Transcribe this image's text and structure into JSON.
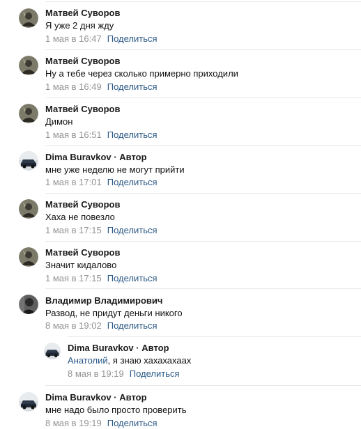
{
  "comments": [
    {
      "author": "Матвей Суворов",
      "text": "Я уже 2 дня жду",
      "date": "1 мая в 16:47",
      "share": "Поделиться",
      "avatar": "dark-figure-avatar"
    },
    {
      "author": "Матвей Суворов",
      "text": "Ну а тебе через сколько примерно приходили",
      "date": "1 мая в 16:49",
      "share": "Поделиться",
      "avatar": "dark-figure-avatar"
    },
    {
      "author": "Матвей Суворов",
      "text": "Димон",
      "date": "1 мая в 16:51",
      "share": "Поделиться",
      "avatar": "dark-figure-avatar"
    },
    {
      "author": "Dima Buravkov",
      "badge": "Автор",
      "text": "мне уже неделю не могут прийти",
      "date": "1 мая в 17:01",
      "share": "Поделиться",
      "avatar": "car-avatar"
    },
    {
      "author": "Матвей Суворов",
      "text": "Хаха не повезло",
      "date": "1 мая в 17:15",
      "share": "Поделиться",
      "avatar": "dark-figure-avatar"
    },
    {
      "author": "Матвей Суворов",
      "text": "Значит кидалово",
      "date": "1 мая в 17:15",
      "share": "Поделиться",
      "avatar": "dark-figure-avatar"
    },
    {
      "author": "Владимир Владимирович",
      "text": "Развод, не придут деньги никого",
      "date": "8 мая в 19:02",
      "share": "Поделиться",
      "avatar": "gray-portrait-avatar"
    },
    {
      "author": "Dima Buravkov",
      "badge": "Автор",
      "mention": "Анатолий",
      "text": ", я знаю хахахахаах",
      "date": "8 мая в 19:19",
      "share": "Поделиться",
      "avatar": "car-avatar",
      "reply": true
    },
    {
      "author": "Dima Buravkov",
      "badge": "Автор",
      "text": "мне надо было просто проверить",
      "date": "8 мая в 19:19",
      "share": "Поделиться",
      "avatar": "car-avatar"
    }
  ],
  "separator": "·",
  "colors": {
    "link": "#2a5885",
    "meta": "#939393",
    "divider": "#e7e8ec"
  }
}
